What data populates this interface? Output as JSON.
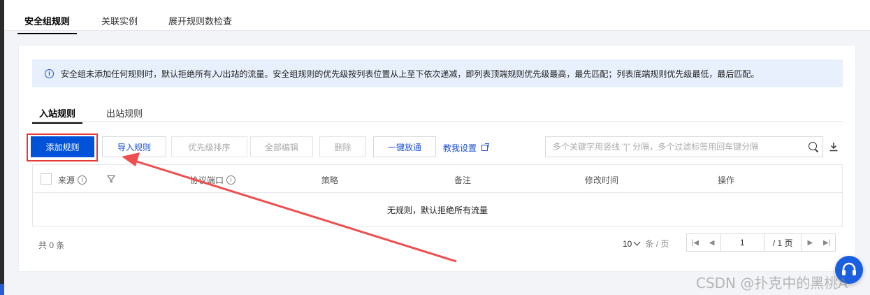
{
  "top_tabs": [
    "安全组规则",
    "关联实例",
    "展开规则数检查"
  ],
  "notice": {
    "icon": "info-icon",
    "text": "安全组未添加任何规则时，默认拒绝所有入/出站的流量。安全组规则的优先级按列表位置从上至下依次递减，即列表顶端规则优先级最高，最先匹配；列表底端规则优先级最低，最后匹配。"
  },
  "sub_tabs": [
    "入站规则",
    "出站规则"
  ],
  "toolbar": {
    "add": "添加规则",
    "import": "导入规则",
    "priority": "优先级排序",
    "edit_all": "全部编辑",
    "delete": "删除",
    "one_click": "一键放通",
    "help_link": "教我设置"
  },
  "search": {
    "placeholder": "多个关键字用竖线 \"|\" 分隔，多个过滤标签用回车键分隔"
  },
  "table": {
    "columns": [
      "来源",
      "协议端口",
      "策略",
      "备注",
      "修改时间",
      "操作"
    ],
    "empty_text": "无规则，默认拒绝所有流量"
  },
  "pagination": {
    "total": "共 0 条",
    "page_size": "10",
    "per_page": "条 / 页",
    "current_page": "1",
    "total_pages": "/ 1 页"
  },
  "watermark": "CSDN @扑克中的黑桃A",
  "colors": {
    "primary": "#0052d9",
    "highlight": "#e53935",
    "notice_bg": "#e8f0fd"
  }
}
